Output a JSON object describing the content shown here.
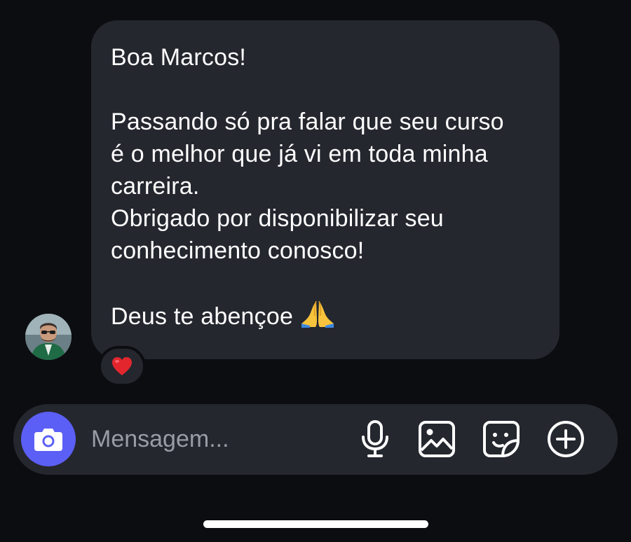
{
  "message": {
    "greeting": "Boa Marcos!",
    "body_lines": [
      "Passando só pra falar que seu curso",
      "é o melhor que já vi em toda minha",
      "carreira.",
      "Obrigado por disponibilizar seu",
      "conhecimento conosco!"
    ],
    "closing": "Deus te abençoe",
    "closing_emoji": "folded-hands-emoji",
    "reaction": "red-heart-emoji"
  },
  "sender": {
    "avatar": "user-avatar-photo"
  },
  "composer": {
    "placeholder": "Mensagem...",
    "value": "",
    "icons": [
      "camera-icon",
      "microphone-icon",
      "gallery-icon",
      "sticker-icon",
      "add-icon"
    ],
    "camera_button_color": "#5c5ff5"
  },
  "colors": {
    "background": "#0c0d11",
    "bubble": "#25272f",
    "text": "#ffffff",
    "placeholder": "#9a9ca5"
  }
}
